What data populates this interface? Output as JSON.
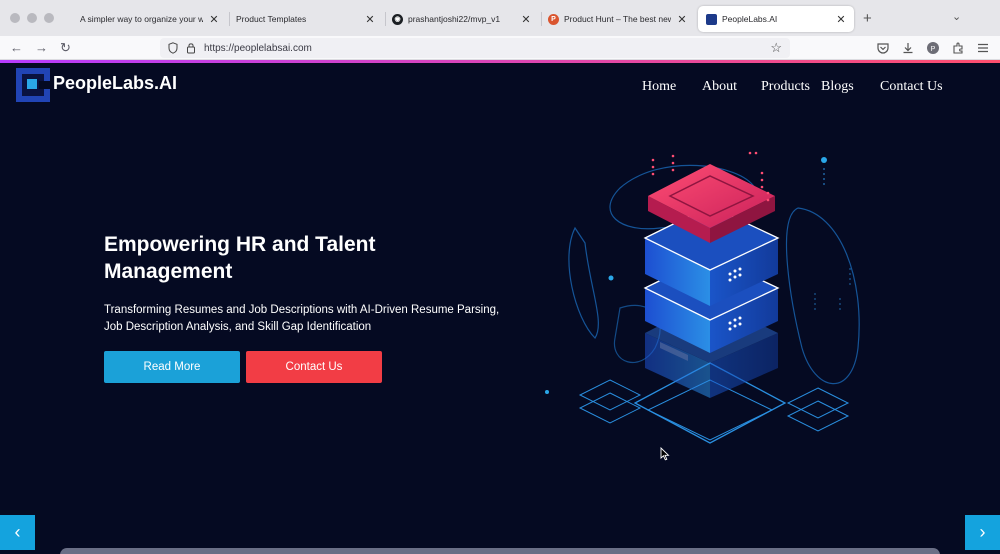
{
  "browser": {
    "tabs": [
      {
        "title": "A simpler way to organize your work",
        "favicon": "none"
      },
      {
        "title": "Product Templates",
        "favicon": "none"
      },
      {
        "title": "prashantjoshi22/mvp_v1",
        "favicon": "github-icon"
      },
      {
        "title": "Product Hunt – The best new products",
        "favicon": "producthunt-icon"
      },
      {
        "title": "PeopleLabs.AI",
        "favicon": "peoplelabs-icon",
        "active": true
      }
    ],
    "url": "https://peoplelabsai.com",
    "new_tab": "+",
    "tab_list": "⌄"
  },
  "site": {
    "logo_text": "PeopleLabs.AI",
    "nav": [
      "Home",
      "About",
      "Products",
      "Blogs",
      "Contact Us"
    ]
  },
  "hero": {
    "title": "Empowering HR and Talent Management",
    "subtitle": "Transforming Resumes and Job Descriptions with AI-Driven Resume Parsing, Job Description Analysis, and Skill Gap Identification",
    "read_more": "Read More",
    "contact_us": "Contact Us"
  },
  "slider": {
    "prev": "‹",
    "next": "›"
  },
  "colors": {
    "page_bg": "#050a22",
    "read_more_bg": "#1ba1d8",
    "contact_bg": "#f23d45",
    "arrow_bg": "#14a3de",
    "accent_gradient_start": "#b73cff",
    "accent_gradient_end": "#ff4f6d"
  }
}
